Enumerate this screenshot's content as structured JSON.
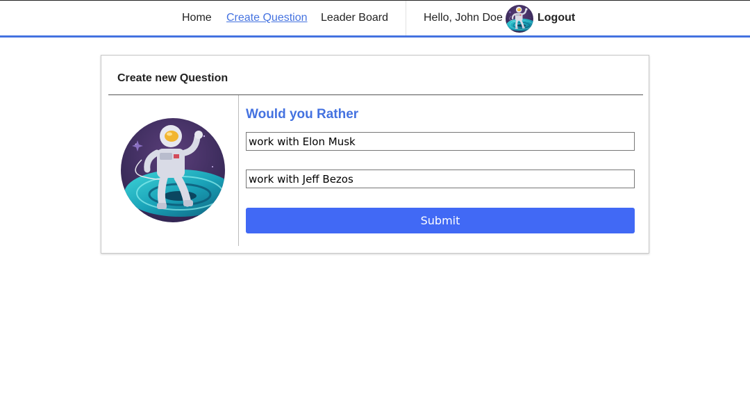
{
  "nav": {
    "home_label": "Home",
    "create_question_label": "Create Question",
    "leader_board_label": "Leader Board",
    "greeting": "Hello, John Doe",
    "logout_label": "Logout",
    "active_tab": "Create Question"
  },
  "card": {
    "header": "Create new Question",
    "prompt": "Would you Rather",
    "option_one_value": "work with Elon Musk",
    "option_two_value": "work with Jeff Bezos",
    "submit_label": "Submit"
  },
  "colors": {
    "accent": "#4472e0",
    "submit_button": "#4169f5",
    "nav_border": "#4472e0"
  },
  "icons": {
    "user_avatar": "astronaut-avatar-icon"
  }
}
